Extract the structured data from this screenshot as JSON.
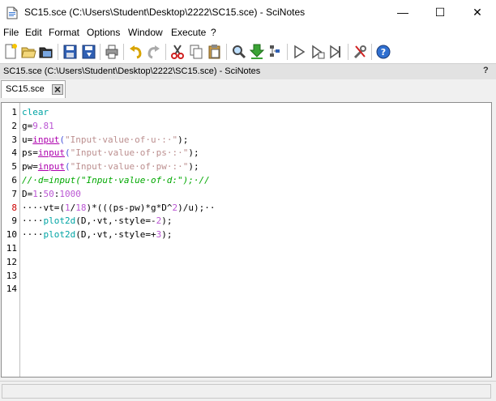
{
  "window": {
    "title": "SC15.sce (C:\\Users\\Student\\Desktop\\2222\\SC15.sce) - SciNotes",
    "minimize": "—",
    "maximize": "☐",
    "close": "✕"
  },
  "menu": [
    "File",
    "Edit",
    "Format",
    "Options",
    "Window",
    "Execute",
    "?"
  ],
  "toolbar": {
    "icons": [
      "new-file-icon",
      "open-folder-icon",
      "open-recent-icon",
      "save-icon",
      "save-as-icon",
      "print-icon",
      "undo-icon",
      "redo-icon",
      "cut-icon",
      "copy-icon",
      "paste-icon",
      "find-icon",
      "load-into-scilab-icon",
      "evaluate-selection-icon",
      "execute-icon",
      "execute-file-icon",
      "execute-until-icon",
      "preferences-icon",
      "help-icon"
    ]
  },
  "panel": {
    "title": "SC15.sce (C:\\Users\\Student\\Desktop\\2222\\SC15.sce) - SciNotes",
    "help": "?"
  },
  "tab": {
    "label": "SC15.sce"
  },
  "editor": {
    "line_numbers": [
      "1",
      "2",
      "3",
      "4",
      "5",
      "6",
      "7",
      "8",
      "9",
      "10",
      "11",
      "12",
      "13",
      "14"
    ],
    "current_line": "8",
    "lines": [
      [
        {
          "t": "clear",
          "c": "#00a4a4"
        }
      ],
      [
        {
          "t": "g=",
          "c": "#000000"
        },
        {
          "t": "9.81",
          "c": "#ba55d3"
        }
      ],
      [
        {
          "t": "u=",
          "c": "#000000"
        },
        {
          "t": "input",
          "c": "#ae00ae",
          "u": true
        },
        {
          "t": "(",
          "c": "#4a55db"
        },
        {
          "t": "\"Input·value·of·u·:·\"",
          "c": "#bc8f8f"
        },
        {
          "t": ");",
          "c": "#000000"
        }
      ],
      [
        {
          "t": "ps=",
          "c": "#000000"
        },
        {
          "t": "input",
          "c": "#ae00ae",
          "u": true
        },
        {
          "t": "(",
          "c": "#4a55db"
        },
        {
          "t": "\"Input·value·of·ps·:·\"",
          "c": "#bc8f8f"
        },
        {
          "t": ");",
          "c": "#000000"
        }
      ],
      [
        {
          "t": "pw=",
          "c": "#000000"
        },
        {
          "t": "input",
          "c": "#ae00ae",
          "u": true
        },
        {
          "t": "(",
          "c": "#4a55db"
        },
        {
          "t": "\"Input·value·of·pw·:·\"",
          "c": "#bc8f8f"
        },
        {
          "t": ");",
          "c": "#000000"
        }
      ],
      [
        {
          "t": "//·d=input(\"Input·value·of·d:\");·//",
          "c": "#01a801",
          "i": true
        }
      ],
      [
        {
          "t": "D=",
          "c": "#000000"
        },
        {
          "t": "1",
          "c": "#ba55d3"
        },
        {
          "t": ":",
          "c": "#000000"
        },
        {
          "t": "50",
          "c": "#ba55d3"
        },
        {
          "t": ":",
          "c": "#000000"
        },
        {
          "t": "1000",
          "c": "#ba55d3"
        }
      ],
      [
        {
          "t": "····vt=(",
          "c": "#000000"
        },
        {
          "t": "1",
          "c": "#ba55d3"
        },
        {
          "t": "/",
          "c": "#000000"
        },
        {
          "t": "18",
          "c": "#ba55d3"
        },
        {
          "t": ")*(((ps-pw)*g*D^",
          "c": "#000000"
        },
        {
          "t": "2",
          "c": "#ba55d3"
        },
        {
          "t": ")/u);··",
          "c": "#000000"
        }
      ],
      [
        {
          "t": "····",
          "c": "#000000"
        },
        {
          "t": "plot2d",
          "c": "#00a4a4"
        },
        {
          "t": "(D,·vt,·style=-",
          "c": "#000000"
        },
        {
          "t": "2",
          "c": "#ba55d3"
        },
        {
          "t": ");",
          "c": "#000000"
        }
      ],
      [
        {
          "t": "····",
          "c": "#000000"
        },
        {
          "t": "plot2d",
          "c": "#00a4a4"
        },
        {
          "t": "(D,·vt,·style=+",
          "c": "#000000"
        },
        {
          "t": "3",
          "c": "#ba55d3"
        },
        {
          "t": ");",
          "c": "#000000"
        }
      ],
      [],
      [],
      [],
      []
    ]
  },
  "status": {
    "text": ""
  }
}
